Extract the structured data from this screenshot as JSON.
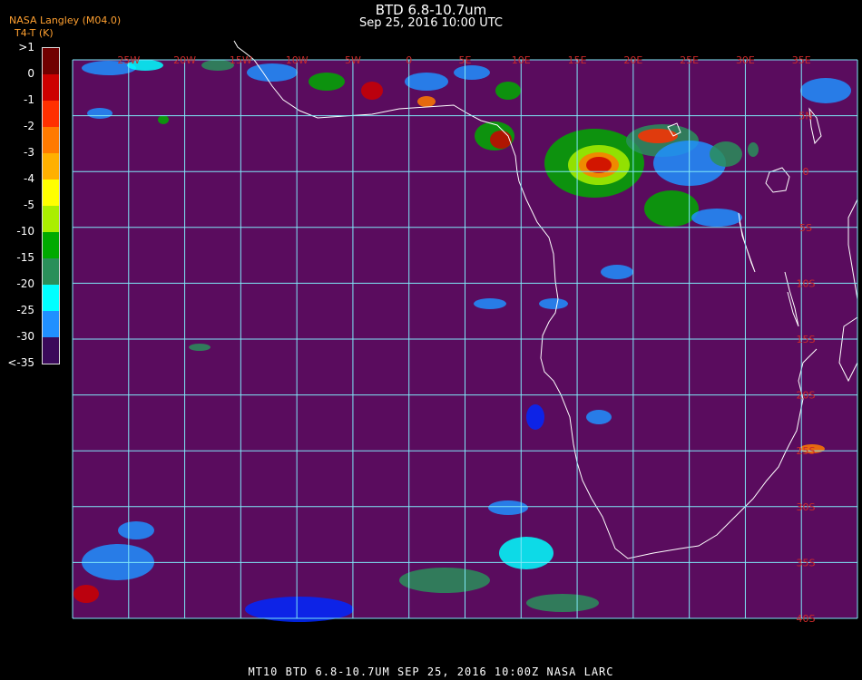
{
  "header": {
    "title": "BTD 6.8-10.7um",
    "datetime": "Sep 25, 2016 10:00 UTC",
    "org": "NASA Langley (M04.0)",
    "btd_label": "BTD",
    "unit": "T4-T (K)"
  },
  "colorbar": {
    "labels": [
      ">1",
      "0",
      "-1",
      "-2",
      "-3",
      "-4",
      "-5",
      "-10",
      "-15",
      "-20",
      "-25",
      "-30",
      "<-35"
    ],
    "colors": [
      "#700000",
      "#cc0000",
      "#ff3000",
      "#ff7a00",
      "#ffb000",
      "#ffff00",
      "#aaee00",
      "#00aa00",
      "#2a8f5a",
      "#00ffff",
      "#2090ff",
      "#0028ff",
      "#3a0a5a"
    ]
  },
  "map": {
    "background": "#5a0c5e",
    "grid_color": "#7fe8f8",
    "label_color": "#cc2a2a",
    "lon_labels": [
      "25W",
      "20W",
      "15W",
      "10W",
      "5W",
      "0",
      "5E",
      "10E",
      "15E",
      "20E",
      "25E",
      "30E",
      "35E"
    ],
    "lat_labels": [
      "5N",
      "0",
      "5S",
      "10S",
      "15S",
      "20S",
      "25S",
      "30S",
      "35S",
      "40S"
    ]
  },
  "footer": {
    "text": "MT10   BTD 6.8-10.7UM    SEP 25, 2016 10:00Z   NASA LARC"
  }
}
